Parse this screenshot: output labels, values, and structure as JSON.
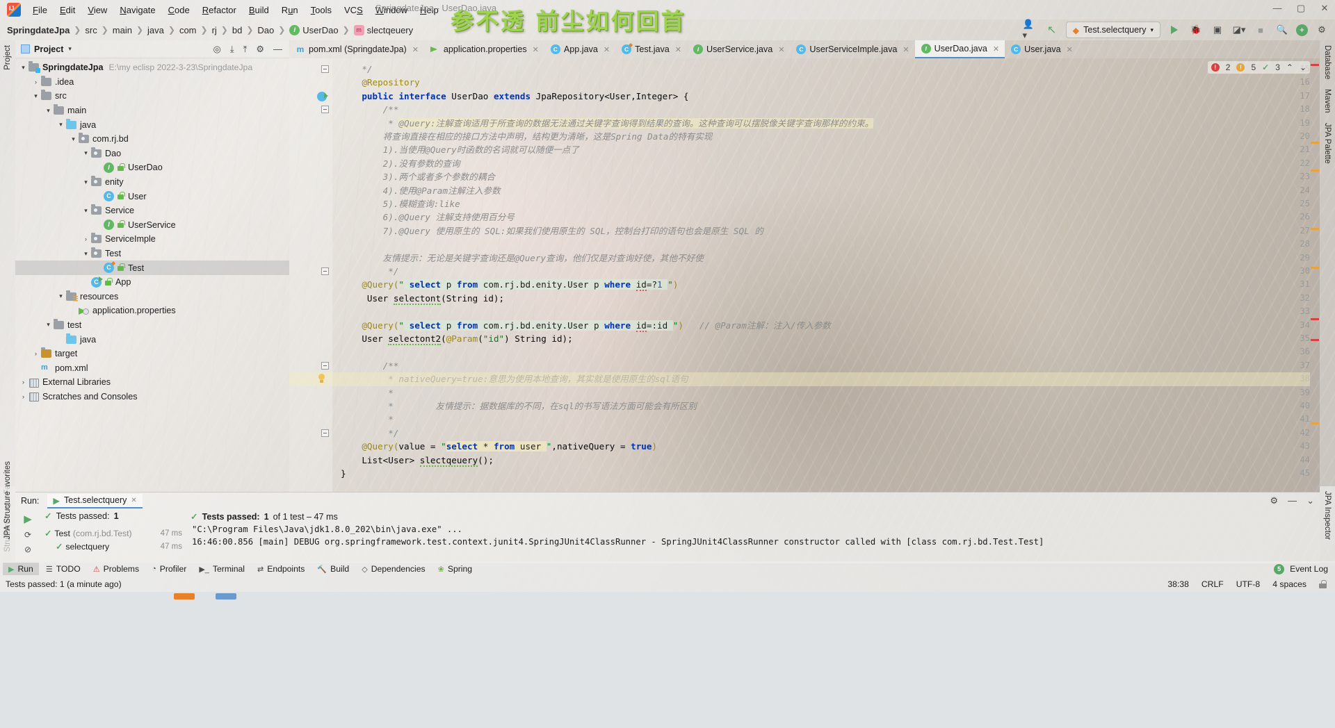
{
  "window": {
    "title": "SpringdateJpa - UserDao.java",
    "watermark": "参不透 前尘如何回首",
    "minimize": "—",
    "maximize": "▢",
    "close": "✕"
  },
  "menubar": {
    "items": [
      "File",
      "Edit",
      "View",
      "Navigate",
      "Code",
      "Refactor",
      "Build",
      "Run",
      "Tools",
      "VCS",
      "Window",
      "Help"
    ]
  },
  "breadcrumb": {
    "project": "SpringdateJpa",
    "items": [
      "src",
      "main",
      "java",
      "com",
      "rj",
      "bd",
      "Dao"
    ],
    "class_icon": "interface-icon",
    "class": "UserDao",
    "method_icon": "method-icon",
    "method": "slectqeuery"
  },
  "toolbar": {
    "profile_icon": "user-profile-icon",
    "updates_icon": "update-arrow-icon",
    "run_config": "Test.selectquery",
    "run_icon": "run-icon",
    "debug_icon": "debug-icon",
    "coverage_icon": "coverage-icon",
    "profiler_icon": "profiler-icon",
    "stop_icon": "stop-icon",
    "search_icon": "search-icon",
    "plugin_icon": "plugin-icon",
    "settings_icon": "settings-icon"
  },
  "rails": {
    "left_top": [
      "Project"
    ],
    "left_bottom": [
      "Structure",
      "Favorites"
    ],
    "left_bottom2": [
      "JPA Structure"
    ],
    "right_top": [
      "Database",
      "Maven",
      "JPA Palette"
    ],
    "right_bottom": [
      "JPA Inspector"
    ]
  },
  "project_panel": {
    "title": "Project",
    "chevron": "▾",
    "actions": [
      "target-icon",
      "collapse-icon",
      "expand-icon",
      "gear-icon",
      "hide-icon"
    ],
    "tree": [
      {
        "depth": 0,
        "arrow": "▾",
        "icon": "module-folder",
        "label": "SpringdateJpa",
        "bold": true,
        "path": "E:\\my eclisp 2022-3-23\\SpringdateJpa"
      },
      {
        "depth": 1,
        "arrow": "›",
        "icon": "folder",
        "label": ".idea"
      },
      {
        "depth": 1,
        "arrow": "▾",
        "icon": "folder",
        "label": "src"
      },
      {
        "depth": 2,
        "arrow": "▾",
        "icon": "folder",
        "label": "main"
      },
      {
        "depth": 3,
        "arrow": "▾",
        "icon": "folder-source",
        "label": "java"
      },
      {
        "depth": 4,
        "arrow": "▾",
        "icon": "package",
        "label": "com.rj.bd"
      },
      {
        "depth": 5,
        "arrow": "▾",
        "icon": "package",
        "label": "Dao"
      },
      {
        "depth": 6,
        "arrow": "",
        "icon": "interface",
        "label": "UserDao"
      },
      {
        "depth": 5,
        "arrow": "▾",
        "icon": "package",
        "label": "enity"
      },
      {
        "depth": 6,
        "arrow": "",
        "icon": "class",
        "label": "User"
      },
      {
        "depth": 5,
        "arrow": "▾",
        "icon": "package",
        "label": "Service"
      },
      {
        "depth": 6,
        "arrow": "",
        "icon": "interface",
        "label": "UserService"
      },
      {
        "depth": 5,
        "arrow": "›",
        "icon": "package",
        "label": "ServiceImple"
      },
      {
        "depth": 5,
        "arrow": "▾",
        "icon": "package",
        "label": "Test"
      },
      {
        "depth": 6,
        "arrow": "",
        "icon": "class-test",
        "label": "Test",
        "selected": true
      },
      {
        "depth": 5,
        "arrow": "",
        "icon": "class-run",
        "label": "App"
      },
      {
        "depth": 3,
        "arrow": "▾",
        "icon": "folder-resources",
        "label": "resources"
      },
      {
        "depth": 4,
        "arrow": "",
        "icon": "properties",
        "label": "application.properties"
      },
      {
        "depth": 2,
        "arrow": "▾",
        "icon": "folder",
        "label": "test"
      },
      {
        "depth": 3,
        "arrow": "",
        "icon": "folder-source",
        "label": "java"
      },
      {
        "depth": 1,
        "arrow": "›",
        "icon": "folder-target",
        "label": "target"
      },
      {
        "depth": 1,
        "arrow": "",
        "icon": "maven",
        "label": "pom.xml"
      },
      {
        "depth": 0,
        "arrow": "›",
        "icon": "library",
        "label": "External Libraries"
      },
      {
        "depth": 0,
        "arrow": "›",
        "icon": "scratches",
        "label": "Scratches and Consoles"
      }
    ]
  },
  "editor_tabs": [
    {
      "icon": "maven-icon",
      "label": "pom.xml (SpringdateJpa)",
      "active": false
    },
    {
      "icon": "properties-icon",
      "label": "application.properties",
      "active": false
    },
    {
      "icon": "class-icon",
      "label": "App.java",
      "active": false
    },
    {
      "icon": "class-test-icon",
      "label": "Test.java",
      "active": false
    },
    {
      "icon": "interface-icon",
      "label": "UserService.java",
      "active": false
    },
    {
      "icon": "class-icon",
      "label": "UserServiceImple.java",
      "active": false
    },
    {
      "icon": "interface-icon",
      "label": "UserDao.java",
      "active": true
    },
    {
      "icon": "class-icon",
      "label": "User.java",
      "active": false
    }
  ],
  "inspection": {
    "errors": "2",
    "warnings": "5",
    "weak_warnings": "3",
    "up_icon": "chevron-up-icon",
    "down_icon": "chevron-down-icon"
  },
  "code": {
    "first_line": 15,
    "lines": [
      {
        "n": 15,
        "marker": "fold",
        "text": "    */"
      },
      {
        "n": 16,
        "text": "    @Repository",
        "type": "annotation"
      },
      {
        "n": 17,
        "marker": "run",
        "text": "    public interface UserDao extends JpaRepository<User,Integer> {"
      },
      {
        "n": 18,
        "marker": "fold",
        "text": "        /**"
      },
      {
        "n": 19,
        "text": "         * @Query:注解查询适用于所查询的数据无法通过关键字查询得到结果的查询。这种查询可以摆脱像关键字查询那样的约束。"
      },
      {
        "n": 20,
        "text": "        将查询直接在相应的接口方法中声明，结构更为清晰，这是Spring Data的特有实现"
      },
      {
        "n": 21,
        "text": "        1).当使用@Query时函数的名词就可以随便一点了"
      },
      {
        "n": 22,
        "text": "        2).没有参数的查询"
      },
      {
        "n": 23,
        "text": "        3).两个或者多个参数的耦合"
      },
      {
        "n": 24,
        "text": "        4).使用@Param注解注入参数"
      },
      {
        "n": 25,
        "text": "        5).模糊查询:like"
      },
      {
        "n": 26,
        "text": "        6).@Query 注解支持使用百分号"
      },
      {
        "n": 27,
        "text": "        7).@Query 使用原生的 SQL:如果我们使用原生的 SQL，控制台打印的语句也会是原生 SQL 的"
      },
      {
        "n": 28,
        "text": ""
      },
      {
        "n": 29,
        "text": "        友情提示：无论是关键字查询还是@Query查询，他们仅是对查询好使，其他不好使"
      },
      {
        "n": 30,
        "marker": "fold",
        "text": "         */"
      },
      {
        "n": 31,
        "text": "    @Query(\" select p from com.rj.bd.enity.User p where id=?1 \")"
      },
      {
        "n": 32,
        "text": "     User selectont(String id);"
      },
      {
        "n": 33,
        "text": ""
      },
      {
        "n": 34,
        "text": "    @Query(\" select p from com.rj.bd.enity.User p where id=:id \")    // @Param注解：注入/传入参数"
      },
      {
        "n": 35,
        "text": "    User selectont2(@Param(\"id\") String id);"
      },
      {
        "n": 36,
        "text": ""
      },
      {
        "n": 37,
        "marker": "fold",
        "text": "        /**"
      },
      {
        "n": 38,
        "marker": "bulb",
        "text": "         * nativeQuery=true:意思为使用本地查询，其实就是使用原生的sql语句"
      },
      {
        "n": 39,
        "text": "         *"
      },
      {
        "n": 40,
        "text": "         *        友情提示：据数据库的不同，在sql的书写语法方面可能会有所区别"
      },
      {
        "n": 41,
        "text": "         *"
      },
      {
        "n": 42,
        "marker": "fold",
        "text": "         */"
      },
      {
        "n": 43,
        "text": "    @Query(value = \" select * from user \",nativeQuery = true)"
      },
      {
        "n": 44,
        "text": "    List<User> slectqeuery();"
      },
      {
        "n": 45,
        "text": "}"
      }
    ]
  },
  "run_panel": {
    "label": "Run:",
    "tab": "Test.selectquery",
    "tab_icon": "run-config-icon",
    "tab_close": "✕",
    "settings_icon": "gear-icon",
    "minimize_icon": "minimize-icon",
    "hide_icon": "hide-icon",
    "toolbar_icons": [
      "rerun-icon",
      "rerun-failed-icon",
      "stop-icon",
      "sort-alpha-icon",
      "sort-duration-icon",
      "filter-icon",
      "expand-icon"
    ],
    "summary_prefix": "Tests passed:",
    "summary_count": "1",
    "summary_suffix": "of 1 test – 47 ms",
    "tree": [
      {
        "depth": 0,
        "status": "passed",
        "label": "Test",
        "suffix": "(com.rj.bd.Test)",
        "time": "47 ms"
      },
      {
        "depth": 1,
        "status": "passed",
        "label": "selectquery",
        "suffix": "",
        "time": "47 ms"
      }
    ],
    "console": [
      "\"C:\\Program Files\\Java\\jdk1.8.0_202\\bin\\java.exe\" ...",
      "16:46:00.856 [main] DEBUG org.springframework.test.context.junit4.SpringJUnit4ClassRunner - SpringJUnit4ClassRunner constructor called with [class com.rj.bd.Test.Test]"
    ]
  },
  "bottom_bar": {
    "items": [
      {
        "icon": "run-icon",
        "label": "Run",
        "active": true
      },
      {
        "icon": "todo-icon",
        "label": "TODO",
        "active": false
      },
      {
        "icon": "problems-icon",
        "label": "Problems",
        "active": false
      },
      {
        "icon": "profiler-icon",
        "label": "Profiler",
        "active": false
      },
      {
        "icon": "terminal-icon",
        "label": "Terminal",
        "active": false
      },
      {
        "icon": "endpoints-icon",
        "label": "Endpoints",
        "active": false
      },
      {
        "icon": "build-icon",
        "label": "Build",
        "active": false
      },
      {
        "icon": "dependencies-icon",
        "label": "Dependencies",
        "active": false
      },
      {
        "icon": "spring-icon",
        "label": "Spring",
        "active": false
      }
    ],
    "event_log": "Event Log",
    "event_badge": "5"
  },
  "status_bar": {
    "message": "Tests passed: 1 (a minute ago)",
    "caret": "38:38",
    "line_sep": "CRLF",
    "encoding": "UTF-8",
    "indent": "4 spaces",
    "lock_icon": "read-write-lock-icon"
  },
  "colors": {
    "accent_blue": "#4d8ecc",
    "green": "#59a869",
    "warning": "#e8a33d",
    "error": "#d64242",
    "watermark_green": "#9ed34e",
    "keyword": "#0033b3",
    "string": "#067d17",
    "annotation": "#9e880d",
    "comment": "#8c8c8c"
  }
}
